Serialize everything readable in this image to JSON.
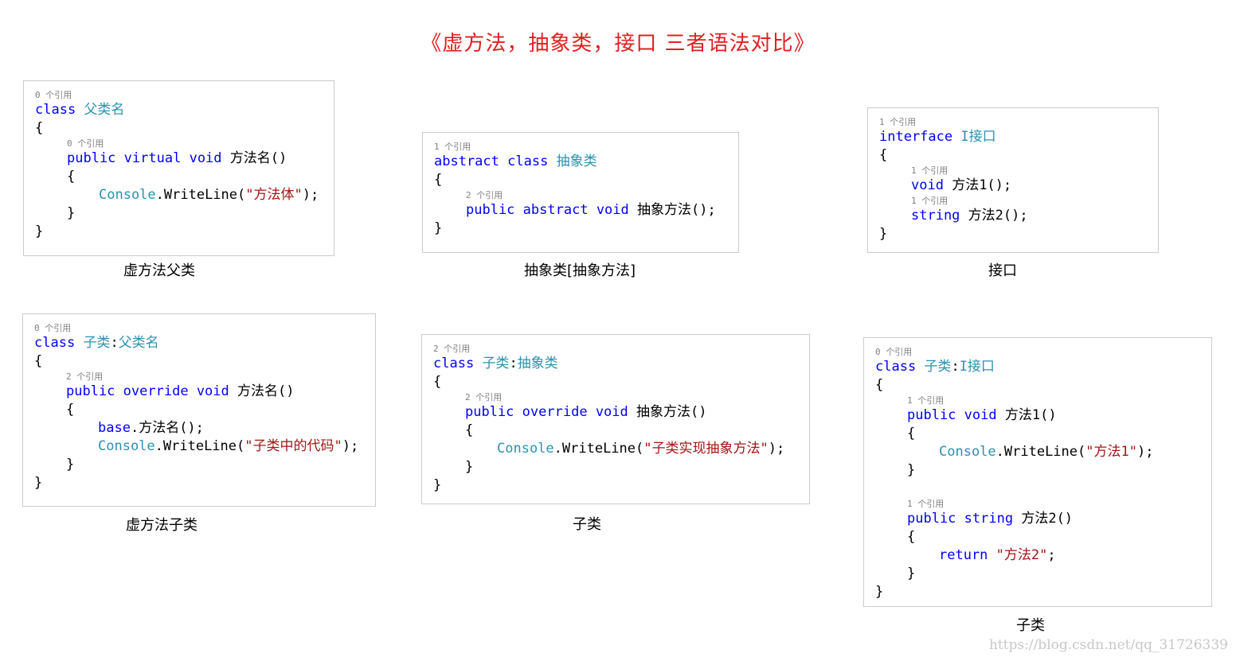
{
  "title": "《虚方法，抽象类，接口 三者语法对比》",
  "watermark": "https://blog.csdn.net/qq_31726339",
  "captions": {
    "p1": "虚方法父类",
    "p2": "抽象类[抽象方法]",
    "p3": "接口",
    "p4": "虚方法子类",
    "p5": "子类",
    "p6": "子类"
  },
  "panels": {
    "p1": [
      {
        "i": 0,
        "ref": "0 个引用"
      },
      {
        "i": 0,
        "t": [
          [
            "kw",
            "class"
          ],
          [
            "cn",
            " "
          ],
          [
            "ty",
            "父类名"
          ]
        ]
      },
      {
        "i": 0,
        "t": [
          [
            "cn",
            "{"
          ]
        ]
      },
      {
        "i": 1,
        "ref": "0 个引用"
      },
      {
        "i": 1,
        "t": [
          [
            "kw",
            "public"
          ],
          [
            "cn",
            " "
          ],
          [
            "kw",
            "virtual"
          ],
          [
            "cn",
            " "
          ],
          [
            "kw",
            "void"
          ],
          [
            "cn",
            " 方法名()"
          ]
        ]
      },
      {
        "i": 1,
        "t": [
          [
            "cn",
            "{"
          ]
        ]
      },
      {
        "i": 2,
        "t": [
          [
            "ty",
            "Console"
          ],
          [
            "cn",
            ".WriteLine("
          ],
          [
            "st",
            "\"方法体\""
          ],
          [
            "cn",
            ");"
          ]
        ]
      },
      {
        "i": 1,
        "t": [
          [
            "cn",
            "}"
          ]
        ]
      },
      {
        "i": 0,
        "t": [
          [
            "cn",
            "}"
          ]
        ]
      }
    ],
    "p2": [
      {
        "i": 0,
        "ref": "1 个引用"
      },
      {
        "i": 0,
        "t": [
          [
            "kw",
            "abstract"
          ],
          [
            "cn",
            " "
          ],
          [
            "kw",
            "class"
          ],
          [
            "cn",
            " "
          ],
          [
            "ty",
            "抽象类"
          ]
        ]
      },
      {
        "i": 0,
        "t": [
          [
            "cn",
            "{"
          ]
        ]
      },
      {
        "i": 1,
        "ref": "2 个引用"
      },
      {
        "i": 1,
        "t": [
          [
            "kw",
            "public"
          ],
          [
            "cn",
            " "
          ],
          [
            "kw",
            "abstract"
          ],
          [
            "cn",
            " "
          ],
          [
            "kw",
            "void"
          ],
          [
            "cn",
            " 抽象方法();"
          ]
        ]
      },
      {
        "i": 0,
        "t": [
          [
            "cn",
            "}"
          ]
        ]
      }
    ],
    "p3": [
      {
        "i": 0,
        "ref": "1 个引用"
      },
      {
        "i": 0,
        "t": [
          [
            "kw",
            "interface"
          ],
          [
            "cn",
            " "
          ],
          [
            "ty",
            "I接口"
          ]
        ]
      },
      {
        "i": 0,
        "t": [
          [
            "cn",
            "{"
          ]
        ]
      },
      {
        "i": 1,
        "ref": "1 个引用"
      },
      {
        "i": 1,
        "t": [
          [
            "kw",
            "void"
          ],
          [
            "cn",
            " 方法1();"
          ]
        ]
      },
      {
        "i": 1,
        "ref": "1 个引用"
      },
      {
        "i": 1,
        "t": [
          [
            "kw",
            "string"
          ],
          [
            "cn",
            " 方法2();"
          ]
        ]
      },
      {
        "i": 0,
        "t": [
          [
            "cn",
            "}"
          ]
        ]
      }
    ],
    "p4": [
      {
        "i": 0,
        "ref": "0 个引用"
      },
      {
        "i": 0,
        "t": [
          [
            "kw",
            "class"
          ],
          [
            "cn",
            " "
          ],
          [
            "ty",
            "子类"
          ],
          [
            "cn",
            ":"
          ],
          [
            "ty",
            "父类名"
          ]
        ]
      },
      {
        "i": 0,
        "t": [
          [
            "cn",
            "{"
          ]
        ]
      },
      {
        "i": 1,
        "ref": "2 个引用"
      },
      {
        "i": 1,
        "t": [
          [
            "kw",
            "public"
          ],
          [
            "cn",
            " "
          ],
          [
            "kw",
            "override"
          ],
          [
            "cn",
            " "
          ],
          [
            "kw",
            "void"
          ],
          [
            "cn",
            " 方法名()"
          ]
        ]
      },
      {
        "i": 1,
        "t": [
          [
            "cn",
            "{"
          ]
        ]
      },
      {
        "i": 2,
        "t": [
          [
            "kw",
            "base"
          ],
          [
            "cn",
            ".方法名();"
          ]
        ]
      },
      {
        "i": 2,
        "t": [
          [
            "ty",
            "Console"
          ],
          [
            "cn",
            ".WriteLine("
          ],
          [
            "st",
            "\"子类中的代码\""
          ],
          [
            "cn",
            ");"
          ]
        ]
      },
      {
        "i": 1,
        "t": [
          [
            "cn",
            "}"
          ]
        ]
      },
      {
        "i": 0,
        "t": [
          [
            "cn",
            "}"
          ]
        ]
      }
    ],
    "p5": [
      {
        "i": 0,
        "ref": "2 个引用"
      },
      {
        "i": 0,
        "t": [
          [
            "kw",
            "class"
          ],
          [
            "cn",
            " "
          ],
          [
            "ty",
            "子类"
          ],
          [
            "cn",
            ":"
          ],
          [
            "ty",
            "抽象类"
          ]
        ]
      },
      {
        "i": 0,
        "t": [
          [
            "cn",
            "{"
          ]
        ]
      },
      {
        "i": 1,
        "ref": "2 个引用"
      },
      {
        "i": 1,
        "t": [
          [
            "kw",
            "public"
          ],
          [
            "cn",
            " "
          ],
          [
            "kw",
            "override"
          ],
          [
            "cn",
            " "
          ],
          [
            "kw",
            "void"
          ],
          [
            "cn",
            " 抽象方法()"
          ]
        ]
      },
      {
        "i": 1,
        "t": [
          [
            "cn",
            "{"
          ]
        ]
      },
      {
        "i": 2,
        "t": [
          [
            "ty",
            "Console"
          ],
          [
            "cn",
            ".WriteLine("
          ],
          [
            "st",
            "\"子类实现抽象方法\""
          ],
          [
            "cn",
            ");"
          ]
        ]
      },
      {
        "i": 1,
        "t": [
          [
            "cn",
            "}"
          ]
        ]
      },
      {
        "i": 0,
        "t": [
          [
            "cn",
            "}"
          ]
        ]
      }
    ],
    "p6": [
      {
        "i": 0,
        "ref": "0 个引用"
      },
      {
        "i": 0,
        "t": [
          [
            "kw",
            "class"
          ],
          [
            "cn",
            " "
          ],
          [
            "ty",
            "子类"
          ],
          [
            "cn",
            ":"
          ],
          [
            "ty",
            "I接口"
          ]
        ]
      },
      {
        "i": 0,
        "t": [
          [
            "cn",
            "{"
          ]
        ]
      },
      {
        "i": 1,
        "ref": "1 个引用"
      },
      {
        "i": 1,
        "t": [
          [
            "kw",
            "public"
          ],
          [
            "cn",
            " "
          ],
          [
            "kw",
            "void"
          ],
          [
            "cn",
            " 方法1()"
          ]
        ]
      },
      {
        "i": 1,
        "t": [
          [
            "cn",
            "{"
          ]
        ]
      },
      {
        "i": 2,
        "t": [
          [
            "ty",
            "Console"
          ],
          [
            "cn",
            ".WriteLine("
          ],
          [
            "st",
            "\"方法1\""
          ],
          [
            "cn",
            ");"
          ]
        ]
      },
      {
        "i": 1,
        "t": [
          [
            "cn",
            "}"
          ]
        ]
      },
      {
        "i": 0,
        "blank": true
      },
      {
        "i": 1,
        "ref": "1 个引用"
      },
      {
        "i": 1,
        "t": [
          [
            "kw",
            "public"
          ],
          [
            "cn",
            " "
          ],
          [
            "kw",
            "string"
          ],
          [
            "cn",
            " 方法2()"
          ]
        ]
      },
      {
        "i": 1,
        "t": [
          [
            "cn",
            "{"
          ]
        ]
      },
      {
        "i": 2,
        "t": [
          [
            "kw",
            "return"
          ],
          [
            "cn",
            " "
          ],
          [
            "st",
            "\"方法2\""
          ],
          [
            "cn",
            ";"
          ]
        ]
      },
      {
        "i": 1,
        "t": [
          [
            "cn",
            "}"
          ]
        ]
      },
      {
        "i": 0,
        "t": [
          [
            "cn",
            "}"
          ]
        ]
      }
    ]
  }
}
